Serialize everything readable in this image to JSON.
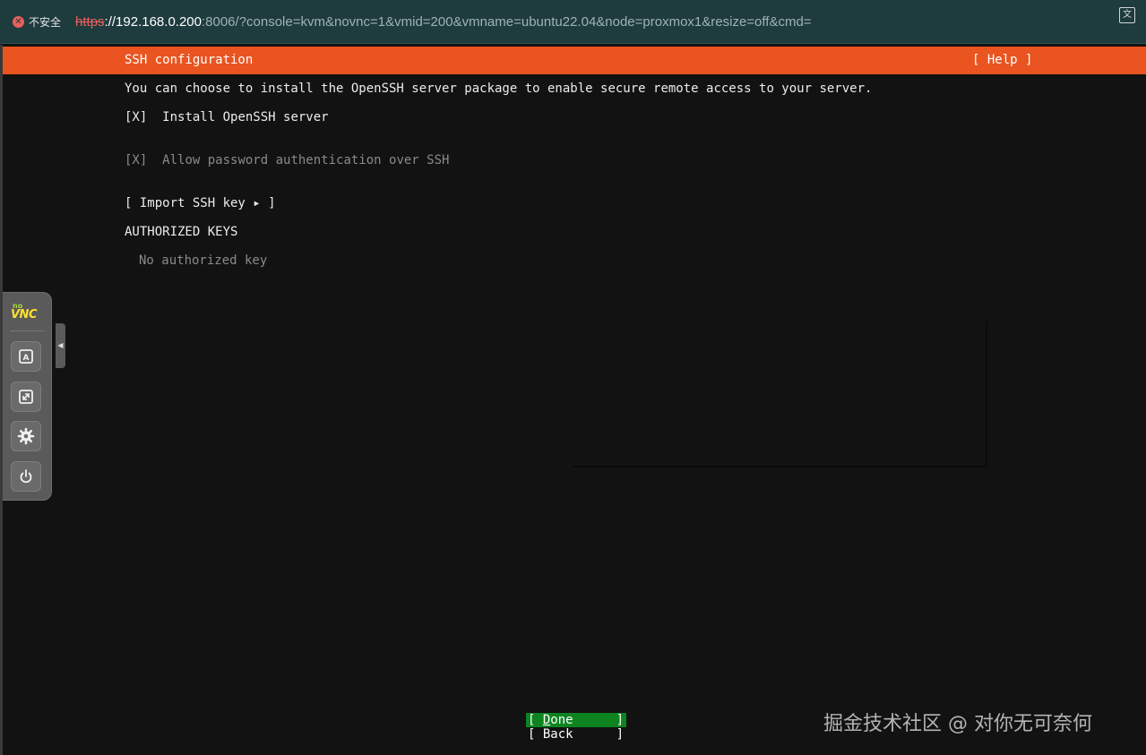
{
  "browser": {
    "security_label": "不安全",
    "url_scheme": "https",
    "url_host": "://192.168.0.200",
    "url_rest": ":8006/?console=kvm&novnc=1&vmid=200&vmname=ubuntu22.04&node=proxmox1&resize=off&cmd="
  },
  "installer": {
    "title": "SSH configuration",
    "help": "[ Help ]",
    "description": "You can choose to install the OpenSSH server package to enable secure remote access to your server.",
    "install_ssh": {
      "box": "[X]",
      "label": "Install OpenSSH server"
    },
    "allow_password": {
      "box": "[X]",
      "label": "Allow password authentication over SSH"
    },
    "import_key": "[ Import SSH key ▸ ]",
    "authorized_heading": "AUTHORIZED KEYS",
    "no_key": "No authorized key",
    "done": {
      "open": "[ ",
      "hotkey": "D",
      "rest": "one",
      "close": "]"
    },
    "back": {
      "open": "[ ",
      "label": "Back",
      "close": "]"
    }
  },
  "novnc": {
    "logo_no": "no",
    "logo_vnc": "VNC",
    "buttons": [
      "keyboard-icon",
      "fullscreen-icon",
      "settings-icon",
      "power-icon"
    ]
  },
  "watermark": "掘金技术社区 @ 对你无可奈何",
  "colors": {
    "ubuntu_orange": "#e95420",
    "selected_green": "#0e8420",
    "background": "#121212"
  }
}
